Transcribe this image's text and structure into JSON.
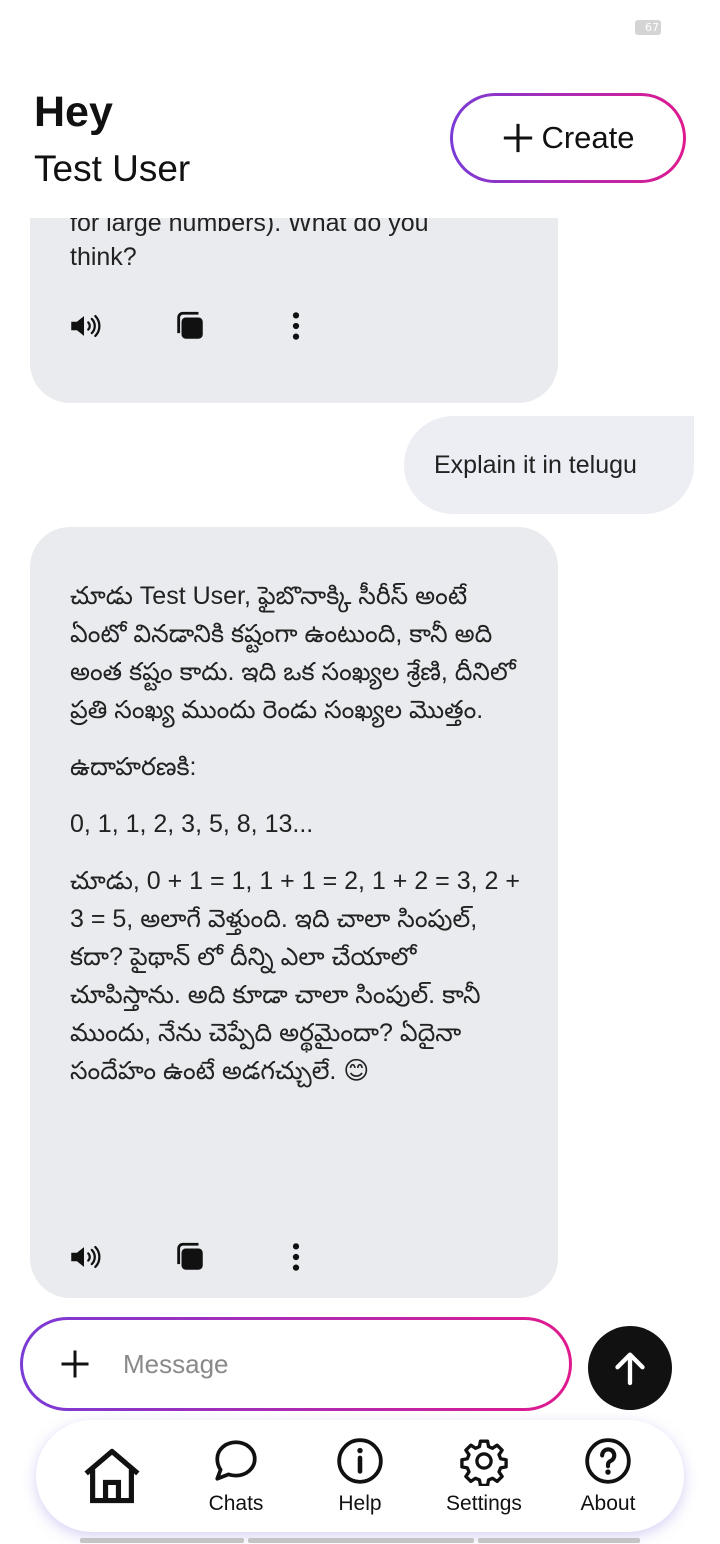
{
  "status_bar": {
    "battery": "67"
  },
  "header": {
    "greeting": "Hey",
    "user_name": "Test User",
    "create_label": "Create"
  },
  "messages": {
    "ai_partial": {
      "lines": [
        "for large numbers).  What do you",
        "think?"
      ]
    },
    "user": {
      "text": "Explain it in telugu"
    },
    "ai_response": {
      "paragraphs": [
        "చూడు Test User, ఫైబొనాక్కి సీరీస్ అంటే ఏంటో వినడానికి కష్టంగా ఉంటుంది, కానీ అది అంత కష్టం కాదు.  ఇది ఒక సంఖ్యల శ్రేణి, దీనిలో ప్రతి సంఖ్య ముందు రెండు సంఖ్యల మొత్తం.",
        "ఉదాహరణకి:",
        "0, 1, 1, 2, 3, 5, 8, 13...",
        "చూడు, 0 + 1 = 1, 1 + 1 = 2, 1 + 2 = 3, 2 + 3 = 5, అలాగే వెళ్తుంది.  ఇది చాలా సింపుల్, కదా?  పైథాన్ లో దీన్ని ఎలా చేయాలో చూపిస్తాను.  అది కూడా చాలా సింపుల్.  కానీ ముందు, నేను చెప్పేది అర్థమైందా? ఏదైనా సందేహం ఉంటే అడగచ్చులే. 😊"
      ]
    }
  },
  "composer": {
    "placeholder": "Message"
  },
  "nav": {
    "items": [
      {
        "label": "",
        "icon": "home-icon"
      },
      {
        "label": "Chats",
        "icon": "chat-icon"
      },
      {
        "label": "Help",
        "icon": "info-icon"
      },
      {
        "label": "Settings",
        "icon": "gear-icon"
      },
      {
        "label": "About",
        "icon": "question-icon"
      }
    ]
  }
}
